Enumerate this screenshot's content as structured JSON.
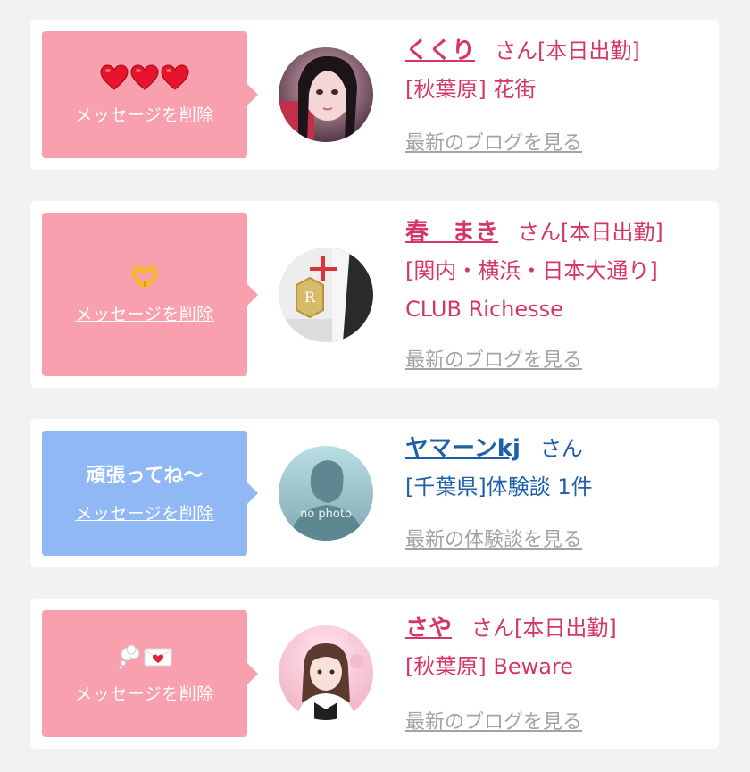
{
  "delete_label": "メッセージを削除",
  "colors": {
    "pink_bubble": "#f8a0ad",
    "blue_bubble": "#8fb8f5",
    "pink_text": "#d63567",
    "blue_text": "#1d5fa8",
    "link_gray": "#a3a3a3"
  },
  "messages": [
    {
      "icons": [
        "heart-emoji",
        "heart-emoji",
        "heart-emoji"
      ],
      "name": "くくり",
      "suffix": "さん[本日出勤]",
      "detail": "[秋葉原] 花街",
      "link": "最新のブログを見る"
    },
    {
      "icons": [
        "heart-hands-emoji"
      ],
      "name": "春　まき",
      "suffix": "さん[本日出勤]",
      "detail": "[関内・横浜・日本大通り] CLUB Richesse",
      "link": "最新のブログを見る"
    },
    {
      "text": "頑張ってね〜",
      "name": "ヤマーンkj",
      "suffix": "さん",
      "detail": "[千葉県]体験談 1件",
      "avatar_text": "no photo",
      "link": "最新の体験談を見る"
    },
    {
      "icons": [
        "thought-balloon-emoji",
        "love-letter-emoji"
      ],
      "name": "さや",
      "suffix": "さん[本日出勤]",
      "detail": "[秋葉原] Beware",
      "link": "最新のブログを見る"
    }
  ]
}
